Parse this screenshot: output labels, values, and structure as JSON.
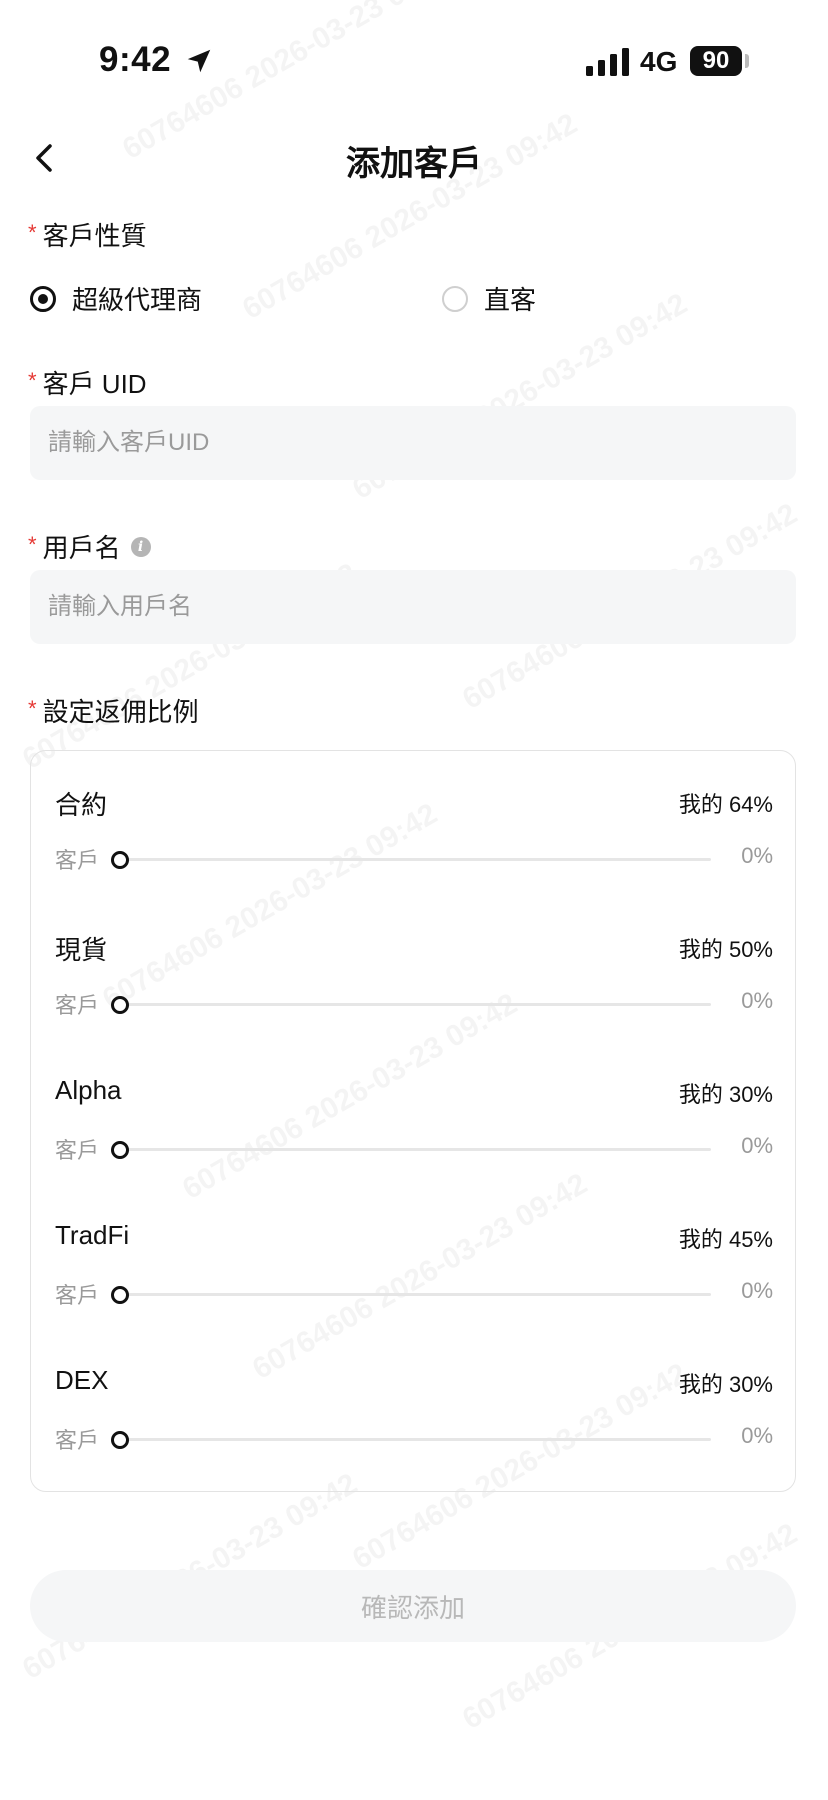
{
  "status_bar": {
    "time": "9:42",
    "network": "4G",
    "battery": "90"
  },
  "header": {
    "title": "添加客戶"
  },
  "customer_type": {
    "label": "客戶性質",
    "options": [
      {
        "label": "超級代理商",
        "selected": true
      },
      {
        "label": "直客",
        "selected": false
      }
    ]
  },
  "uid": {
    "label": "客戶 UID",
    "placeholder": "請輸入客戶UID",
    "value": ""
  },
  "username": {
    "label": "用戶名",
    "placeholder": "請輸入用戶名",
    "value": ""
  },
  "rebate": {
    "label": "設定返佣比例",
    "client_label": "客戶",
    "items": [
      {
        "name": "合約",
        "mine": "我的 64%",
        "client": "0%"
      },
      {
        "name": "現貨",
        "mine": "我的 50%",
        "client": "0%"
      },
      {
        "name": "Alpha",
        "mine": "我的 30%",
        "client": "0%"
      },
      {
        "name": "TradFi",
        "mine": "我的 45%",
        "client": "0%"
      },
      {
        "name": "DEX",
        "mine": "我的 30%",
        "client": "0%"
      }
    ]
  },
  "confirm_label": "確認添加",
  "watermark": "60764606 2026-03-23 09:42",
  "colors": {
    "required": "#e53935",
    "input_bg": "#f5f6f7",
    "muted": "#9a9a9a"
  }
}
